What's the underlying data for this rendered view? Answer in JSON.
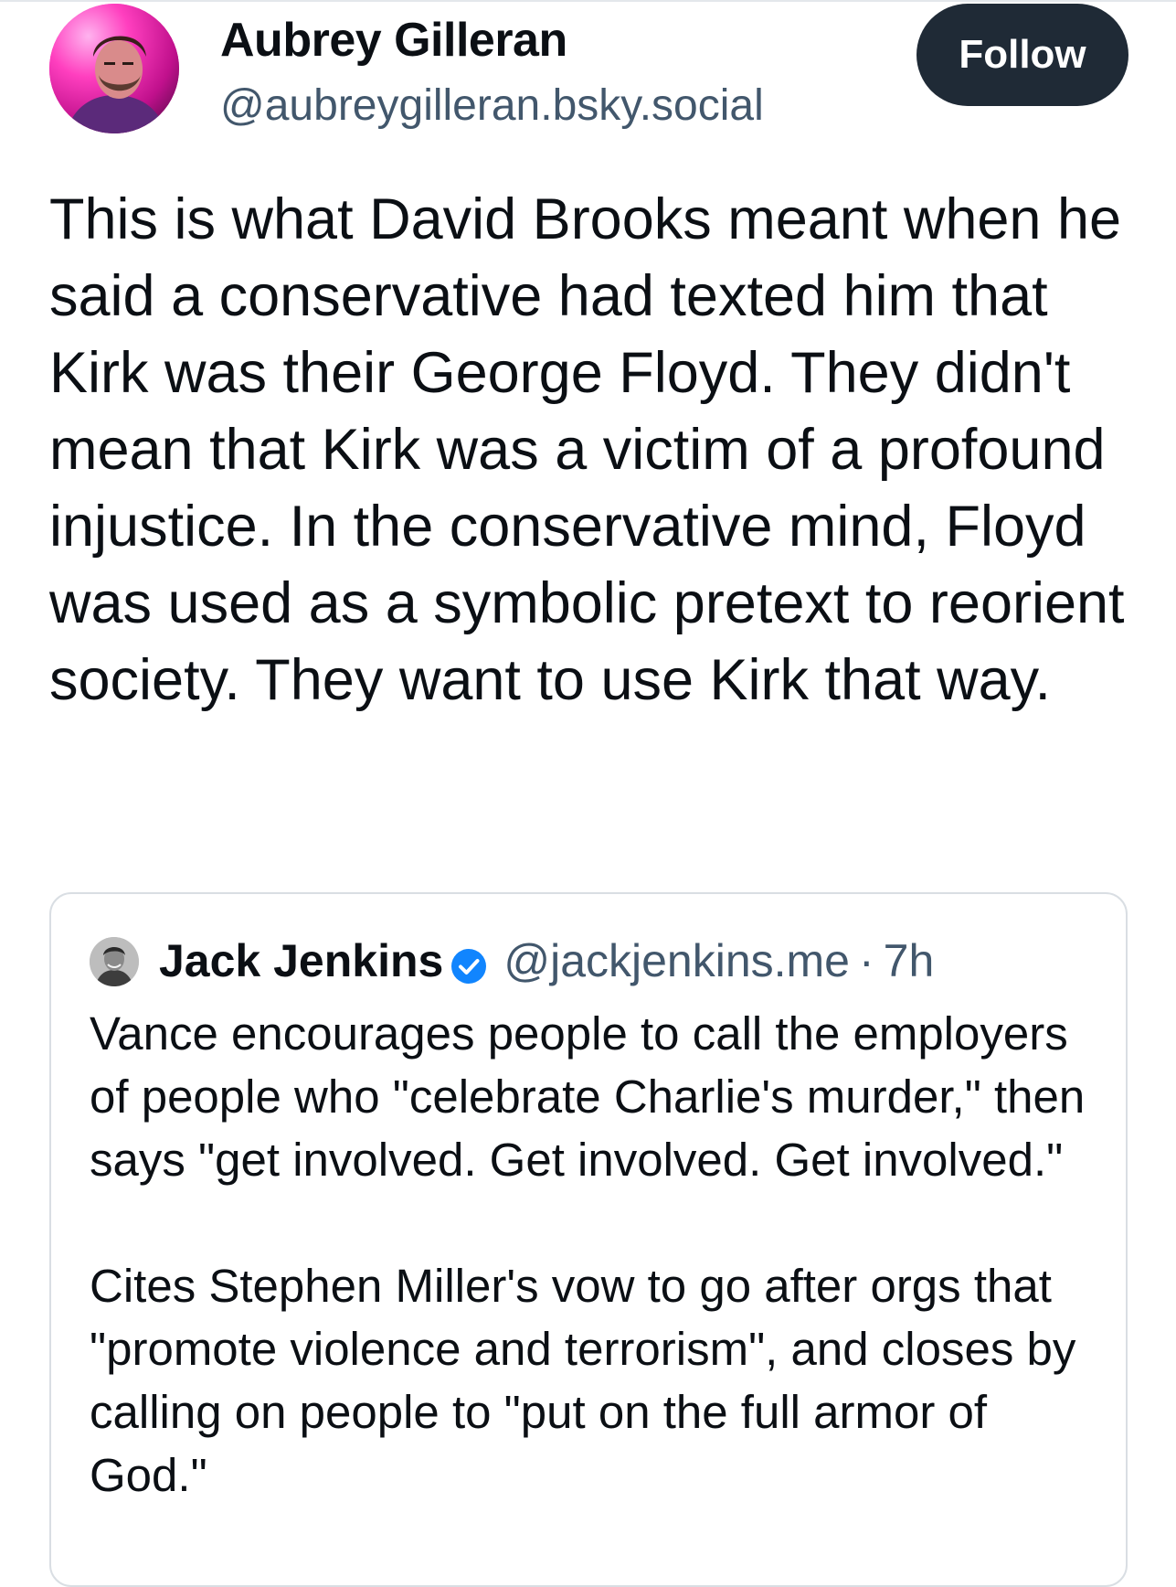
{
  "post": {
    "author_name": "Aubrey Gilleran",
    "author_handle": "@aubreygilleran.bsky.social",
    "follow_label": "Follow",
    "text": "This is what David Brooks meant when he said a conservative had texted him that Kirk was their George Floyd. They didn't mean that Kirk was a victim of a profound injustice. In the conservative mind, Floyd was used as a symbolic pretext to reorient society. They want to use Kirk that way."
  },
  "quote": {
    "author_name": "Jack Jenkins",
    "author_handle": "@jackjenkins.me",
    "separator": "·",
    "timestamp": "7h",
    "verified": true,
    "text": "Vance encourages people to call the employers of people who \"celebrate Charlie's murder,\" then says \"get involved. Get involved. Get involved.\"\n\nCites Stephen Miller's vow to go after orgs that \"promote violence and terrorism\", and closes by calling on people to \"put on the full armor of God.\""
  },
  "colors": {
    "follow_button_bg": "#1f2a36",
    "handle_text": "#42576c",
    "verified_badge": "#1185fe",
    "card_border": "#d9dee3"
  },
  "icons": {
    "author_avatar": "avatar",
    "quote_avatar": "avatar",
    "verified": "verified-check-icon"
  }
}
